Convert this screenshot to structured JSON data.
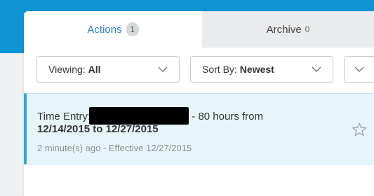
{
  "tabs": [
    {
      "label": "Actions",
      "count": "1"
    },
    {
      "label": "Archive",
      "count": "0"
    }
  ],
  "filters": {
    "viewing_prefix": "Viewing:",
    "viewing_value": "All",
    "sort_prefix": "Sort By:",
    "sort_value": "Newest"
  },
  "card": {
    "title_prefix": "Time Entry:",
    "title_suffix": "- 80 hours from",
    "title_line2": "12/14/2015 to 12/27/2015",
    "meta": "2 minute(s) ago - Effective 12/27/2015"
  },
  "colors": {
    "topbar": "#0f94d6",
    "accent": "#2ea8e0",
    "active_tab_text": "#2d7fc4"
  },
  "icons": {
    "dropdown": "chevron-down-icon",
    "favorite": "star-icon"
  }
}
